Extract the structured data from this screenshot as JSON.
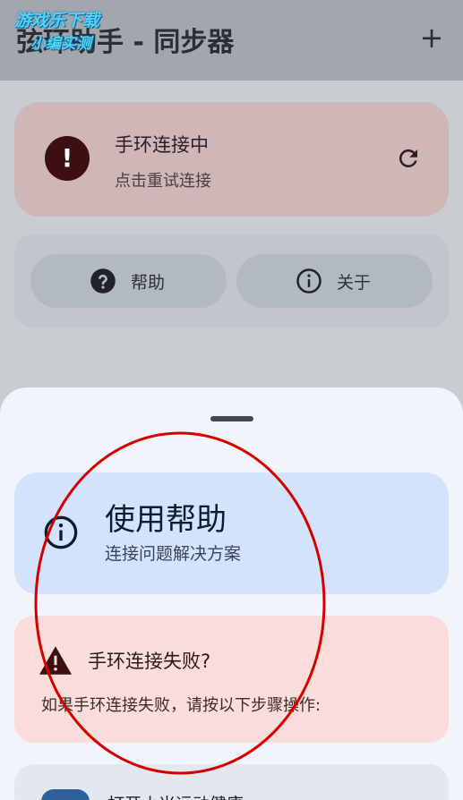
{
  "watermark": {
    "line1": "游戏乐下载",
    "line2": "小编实测"
  },
  "appbar": {
    "title": "弦环助手 - 同步器",
    "add_label": "+"
  },
  "status_card": {
    "title": "手环连接中",
    "subtitle": "点击重试连接",
    "icon_glyph": "!"
  },
  "actions": {
    "help_label": "帮助",
    "about_label": "关于"
  },
  "sheet": {
    "help_card": {
      "title": "使用帮助",
      "subtitle": "连接问题解决方案"
    },
    "fail_card": {
      "title": "手环连接失败?",
      "body": "如果手环连接失败，请按以下步骤操作:"
    },
    "step_card": {
      "title": "打开小米运动健康"
    }
  },
  "colors": {
    "status_bg": "#cfb6b7",
    "help_bg": "#d3e3fd",
    "fail_bg": "#fadcda",
    "annotation": "#d40000"
  }
}
